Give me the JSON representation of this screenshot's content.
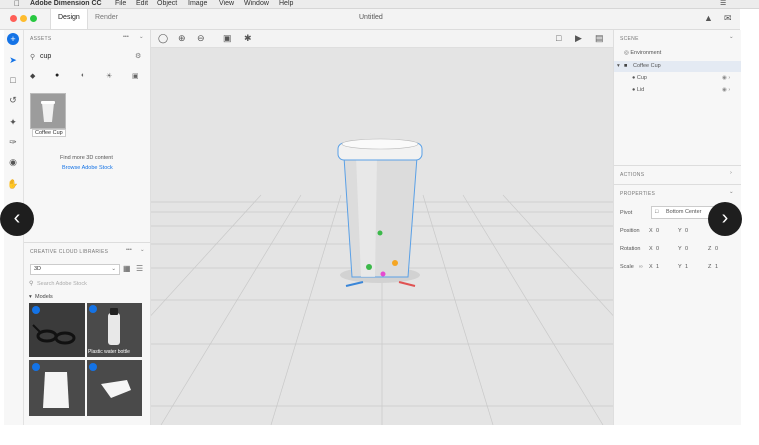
{
  "menubar": {
    "app_name": "Adobe Dimension CC",
    "items": [
      "File",
      "Edit",
      "Object",
      "Image",
      "View",
      "Window",
      "Help"
    ]
  },
  "titlebar": {
    "tabs": [
      "Design",
      "Render"
    ],
    "document_title": "Untitled"
  },
  "assets": {
    "header": "ASSETS",
    "search_value": "cup",
    "item_label": "Coffee Cup",
    "find_more": "Find more 3D content",
    "browse_link": "Browse Adobe Stock"
  },
  "cc_libraries": {
    "header": "CREATIVE CLOUD LIBRARIES",
    "select_value": "3D",
    "search_placeholder": "Search Adobe Stock",
    "section": "Models",
    "thumb_label": "Plastic water bottle"
  },
  "scene": {
    "header": "SCENE",
    "items": [
      "Environment",
      "Coffee Cup",
      "Cup",
      "Lid"
    ]
  },
  "actions": {
    "header": "ACTIONS"
  },
  "properties": {
    "header": "PROPERTIES",
    "pivot_label": "Pivot",
    "pivot_value": "Bottom Center",
    "position_label": "Position",
    "rotation_label": "Rotation",
    "scale_label": "Scale",
    "position": {
      "x": "0",
      "y": "0",
      "z": "0"
    },
    "rotation": {
      "x": "0",
      "y": "0",
      "z": "0"
    },
    "scale": {
      "x": "1",
      "y": "1",
      "z": "1"
    },
    "axis_x": "X",
    "axis_y": "Y",
    "axis_z": "Z"
  },
  "colors": {
    "accent": "#1473e6",
    "selection": "#5aa0e6",
    "light_red": "#ff5f57",
    "light_yellow": "#febc2e",
    "light_green": "#28c840"
  }
}
